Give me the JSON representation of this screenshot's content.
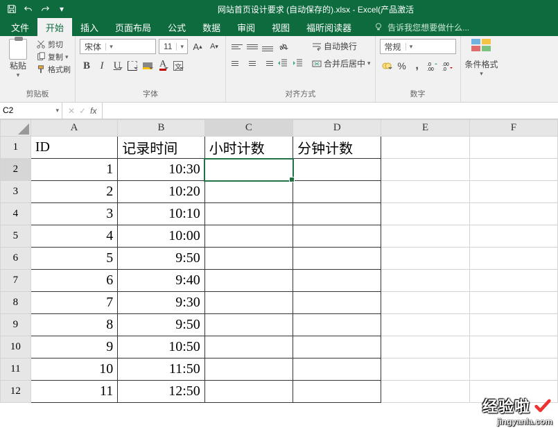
{
  "window_title": "网站首页设计要求 (自动保存的).xlsx - Excel(产品激活",
  "tabs": {
    "file": "文件",
    "home": "开始",
    "insert": "插入",
    "layout": "页面布局",
    "formula": "公式",
    "data": "数据",
    "review": "审阅",
    "view": "视图",
    "foxit": "福昕阅读器"
  },
  "tell_me": "告诉我您想要做什么...",
  "clipboard": {
    "paste": "粘贴",
    "cut": "剪切",
    "copy": "复制",
    "format_painter": "格式刷",
    "label": "剪贴板"
  },
  "font": {
    "name": "宋体",
    "size": "11",
    "label": "字体",
    "bold": "B",
    "italic": "I",
    "underline": "U",
    "colorA": "A",
    "fontinc": "A",
    "fontdec": "A",
    "wen": "文"
  },
  "align": {
    "wrap": "自动换行",
    "merge": "合并后居中",
    "label": "对齐方式"
  },
  "number": {
    "format": "常规",
    "label": "数字",
    "pct": "%",
    "comma": ","
  },
  "cond": {
    "label": "条件格式"
  },
  "namebox": "C2",
  "formula": "",
  "columns": [
    "A",
    "B",
    "C",
    "D",
    "E",
    "F"
  ],
  "rows_head": [
    "1",
    "2",
    "3",
    "4",
    "5",
    "6",
    "7",
    "8",
    "9",
    "10",
    "11",
    "12"
  ],
  "headers": {
    "A": "ID",
    "B": "记录时间",
    "C": "小时计数",
    "D": "分钟计数"
  },
  "chart_data": {
    "type": "table",
    "title": "",
    "columns": [
      "ID",
      "记录时间",
      "小时计数",
      "分钟计数"
    ],
    "rows": [
      {
        "ID": 1,
        "记录时间": "10:30",
        "小时计数": "",
        "分钟计数": ""
      },
      {
        "ID": 2,
        "记录时间": "10:20",
        "小时计数": "",
        "分钟计数": ""
      },
      {
        "ID": 3,
        "记录时间": "10:10",
        "小时计数": "",
        "分钟计数": ""
      },
      {
        "ID": 4,
        "记录时间": "10:00",
        "小时计数": "",
        "分钟计数": ""
      },
      {
        "ID": 5,
        "记录时间": "9:50",
        "小时计数": "",
        "分钟计数": ""
      },
      {
        "ID": 6,
        "记录时间": "9:40",
        "小时计数": "",
        "分钟计数": ""
      },
      {
        "ID": 7,
        "记录时间": "9:30",
        "小时计数": "",
        "分钟计数": ""
      },
      {
        "ID": 8,
        "记录时间": "9:50",
        "小时计数": "",
        "分钟计数": ""
      },
      {
        "ID": 9,
        "记录时间": "10:50",
        "小时计数": "",
        "分钟计数": ""
      },
      {
        "ID": 10,
        "记录时间": "11:50",
        "小时计数": "",
        "分钟计数": ""
      },
      {
        "ID": 11,
        "记录时间": "12:50",
        "小时计数": "",
        "分钟计数": ""
      }
    ]
  },
  "watermark": {
    "brand": "经验啦",
    "url": "jingyanla.com"
  }
}
